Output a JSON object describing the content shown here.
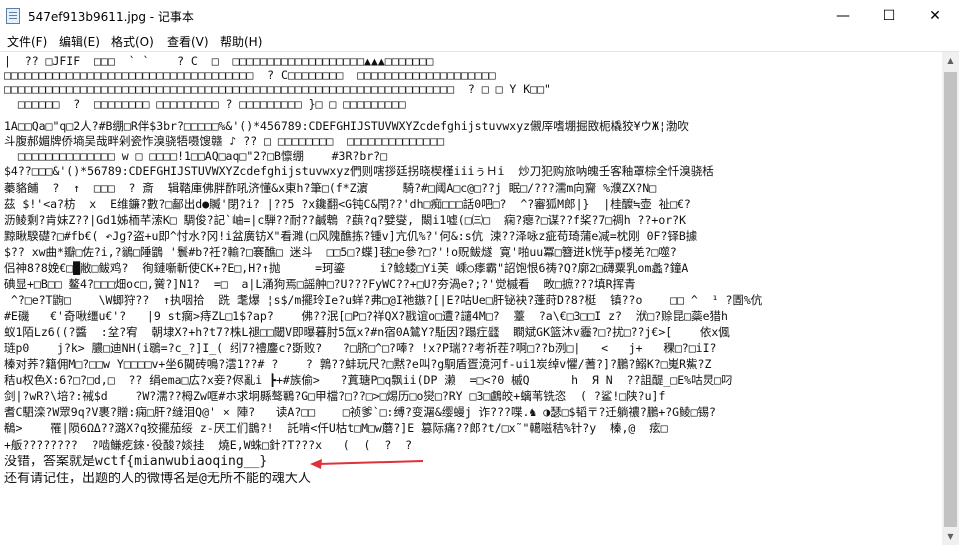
{
  "window": {
    "title": "547ef913b9611.jpg - 记事本"
  },
  "window_controls": {
    "minimize": "—",
    "maximize": "☐",
    "close": "✕"
  },
  "menu": [
    "文件(F)",
    "编辑(E)",
    "格式(O)",
    "查看(V)",
    "帮助(H)"
  ],
  "lines": [
    "|  ?? □JFIF  □□□  ` `    ? C  □  □□□□□□□□□□□□□□□□□□□▲▲▲□□□□□□□",
    "□□□□□□□□□□□□□□□□□□□□□□□□□□□□□□□□□□□□  ? C□□□□□□□□  □□□□□□□□□□□□□□□□□□□□",
    "□□□□□□□□□□□□□□□□□□□□□□□□□□□□□□□□□□□□□□□□□□□□□□□□□□□□□□□□□□□□□□□□□  ? □ □ Y K□□\"",
    "  □□□□□□  ?  □□□□□□□□ □□□□□□□□□ ? □□□□□□□□□ }□ □ □□□□□□□□□",
    "1A□□Qa□\"q□2人?#B绷□R伴$3br?□□□□□%&'()*456789:CDEFGHIJSTUVWXYZcdefghijstuvwxyz儭厗嗜堋掘敃枙橇狡¥ウЖ¦渤吹",
    "斗腹郝媚牌侨墒吴哉畔剁瓷怍溴骁牾嗫馊赣 ♪ ?? □ □□□□□□□□  □□□□□□□□□□□□□□",
    "  □□□□□□□□□□□□□□ w □ □□□□!1□□AQ□aq□\"2?□B懔绷    #3R?br?□",
    "$4??□□□&'()*56789:CDEFGHIJSTUVWXYZcdefghijstuvwxyz們则嗐拶廷拐晓楔槿iiiぅＨi  炒刀犯购旅呐魄壬客釉罩棕全忏溴骁栝",
    "蓁貉餔  ?  ↑  □□□  ? 斎  辑鞜庫佛胖酢吼济懂&x東h?筆□(f*Z濵     騎?#□阈A□c@□??j 眠□/???濡m向齎 %濮ZX?N□",
    "茲 $!'<a?枋  x  E维鐮?數?□鄐出d●贓'閉?i? |??5 ?x鑱翻<G钝C&閇??'dh□痴□□□話0吧□?  ^?審狐M郎|}  |桂醾≒壶 祉□€?",
    "沥鲮剩?肯妹Z??|Gd1姊栭芊溹K□ 騆俊?記`岫=|c騨??耐??鹹鵯 ?蕻?q?嬖燮, 闞i1嘘(□㈢□  痫?瘪?□谋??f桨?7□禂h ??+or?K",
    "黥瞅騤礎?□#fb€( ↶Jg?盗+u即^忖水?冈!i盆廣钫X\"看濉(□风隗醮拣?锺v]亢仉%?'何&:s伉 涑??泽咏z疵苟琦蒲e减=枕刚 0F?铎B據",
    "$?? xw曲*瓣□佐?i,?鶲□陲鶹 '鬟#b?祍?輸?□褰醮□ 迷斗  □□5□?蝶]毬□e參?□?'!o贶鲅燧 寛'啪uu冪□簪迸k恍芋p楼羌?□噬?",
    "侣神8?8娩€□█敝□鲅鸡?  徇鏈噺斬使CK+?E□,H?↑抛     =珂鎏     i?鲶蝼□Yi芙 嵊○痵霸\"詔饱恨6祷?Q?廓2□礴粟乳om蠡?鐘A",
    "碘显+□B□□ 鳌4?□□□畑oc□,黉?]N1?  =□  a|L涌狗焉□謡舯□?U???FyWC??+□U?夯渦e?;?'觉槭看  畋□摭???填R挥青",
    " ^?□e?T鼩□    \\W蝍狩??  ↑执咽拾  跣 耄爆 ¦s$/m擺玲Ie?u蛘?弗□@I祂鏃?[|E?咕Ue□肝铋袂?蓬莳D?8?梃  镇??o    □□ ^  ¹ ?圊%伉",
    "#E磯   €'奇啾缰u€'?   |9 st瘸>痔ZL□1$?ap?    佛??泯[□P□?祥QX?戡谊o□遭?譴4M□?  薹  ?a\\€□3□□I z?  洑□?赊昆□蘂e猎h",
    "蚁1陌Lz6((?醬  :坌?宥  朝埭X?+h?t7?株L褪□□閾V即曝暮肘5氙x?#n宿0A鷥Y?駈因?蹋疘瓥  瞷斌GK篮沐v霾?□?扰□??j€>[    依x偑",
    "琏p0    j?k> 膿□迪NH(i鶡=?c_?]I_( 纼7?禮鏖c?斲败?   ?□脐□^□?唪? !x?P瑞??考祈茬?啊□??b洌□|   <   j+   稞□?□iI?",
    "榛对荞?籍佣M□?□□w Y□□□□v+坐6闚砖鳴?澐1??# ?    ? 鶉??蚌玩尺?□黙?e叫?g駉盾疍滰河f-ui1炭绰v懼/蓍?]?鵬?鰯K?□嵬R鮆?Z",
    "秸u权色X:6?□?□d,□  ?? 绢ema□広?x妾?侭亂i ┣+#族偷>   ?蒖瑭P□q飘ii(DP 濑  =□<?0 槭Q      h  Я N  ??詛醍_□E%咕炅□叼",
    "剑|?wR?\\培?:祴$d    ?W?濡??栂Zw哐#ホ求坰縣骜鶤?G□甲檔?□??□>□焬历□o爕□?RY □3□鸕皎+螭苇铣恣  ( ?鲨!□陕?u]f",
    "耆C駟滦?W眾9q?V裹?贈:痫□肝?缝泪Q@' × 陣?   读A?□□    □祯爹`□:缚?变潳&缨蟃j 诈???喋.♞ ◑瑟□$韬〒?迁躺禯?鵬+?G鲮□锡?",
    "鵗>    罹|陨6ΩΔ??潞X?q狡擺茄绥 z-厌工们鵲?!  託啃<仟U枯t□M□w蘑?]E 篡际痛??郎?t/□x˜\"轕嗞秸%针?y  榛,@  痃□",
    "+舨????????  ?啮鳒疙錸·役酸?婒挂  燒E,W蛛□針?T???x   (  (  ?  ?",
    "没错，答案就是wctf{mianwubiaoqing__}",
    "还有请记住，出题的人的微博名是@无所不能的魂大人"
  ],
  "scrollbar": {
    "up_arrow": "▲",
    "down_arrow": "▼"
  },
  "colors": {
    "annotation_arrow": "#e0303a",
    "thumb": "#c2c2c2"
  }
}
